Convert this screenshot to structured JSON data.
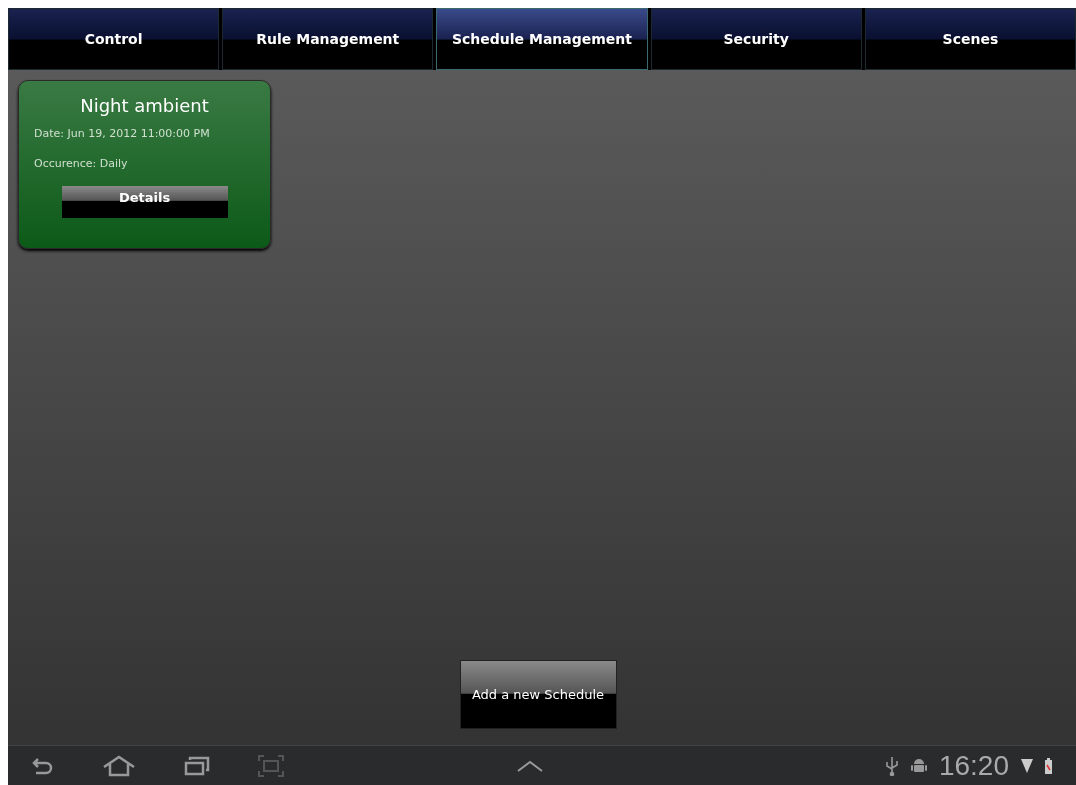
{
  "tabs": [
    {
      "label": "Control",
      "selected": false
    },
    {
      "label": "Rule Management",
      "selected": false
    },
    {
      "label": "Schedule Management",
      "selected": true
    },
    {
      "label": "Security",
      "selected": false
    },
    {
      "label": "Scenes",
      "selected": false
    }
  ],
  "schedules": [
    {
      "title": "Night ambient",
      "date": "Date: Jun 19, 2012 11:00:00 PM",
      "occurrence": "Occurence: Daily",
      "button": "Details"
    }
  ],
  "add_button": "Add a new Schedule",
  "status_bar": {
    "time": "16:20"
  }
}
